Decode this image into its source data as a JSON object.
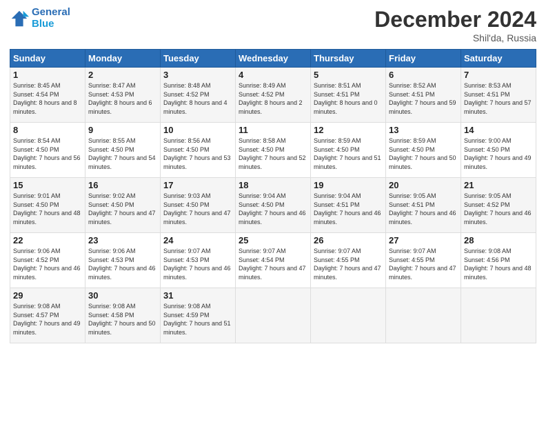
{
  "logo": {
    "line1": "General",
    "line2": "Blue"
  },
  "title": "December 2024",
  "location": "Shil'da, Russia",
  "days_of_week": [
    "Sunday",
    "Monday",
    "Tuesday",
    "Wednesday",
    "Thursday",
    "Friday",
    "Saturday"
  ],
  "weeks": [
    [
      {
        "day": "1",
        "sunrise": "Sunrise: 8:45 AM",
        "sunset": "Sunset: 4:54 PM",
        "daylight": "Daylight: 8 hours and 8 minutes."
      },
      {
        "day": "2",
        "sunrise": "Sunrise: 8:47 AM",
        "sunset": "Sunset: 4:53 PM",
        "daylight": "Daylight: 8 hours and 6 minutes."
      },
      {
        "day": "3",
        "sunrise": "Sunrise: 8:48 AM",
        "sunset": "Sunset: 4:52 PM",
        "daylight": "Daylight: 8 hours and 4 minutes."
      },
      {
        "day": "4",
        "sunrise": "Sunrise: 8:49 AM",
        "sunset": "Sunset: 4:52 PM",
        "daylight": "Daylight: 8 hours and 2 minutes."
      },
      {
        "day": "5",
        "sunrise": "Sunrise: 8:51 AM",
        "sunset": "Sunset: 4:51 PM",
        "daylight": "Daylight: 8 hours and 0 minutes."
      },
      {
        "day": "6",
        "sunrise": "Sunrise: 8:52 AM",
        "sunset": "Sunset: 4:51 PM",
        "daylight": "Daylight: 7 hours and 59 minutes."
      },
      {
        "day": "7",
        "sunrise": "Sunrise: 8:53 AM",
        "sunset": "Sunset: 4:51 PM",
        "daylight": "Daylight: 7 hours and 57 minutes."
      }
    ],
    [
      {
        "day": "8",
        "sunrise": "Sunrise: 8:54 AM",
        "sunset": "Sunset: 4:50 PM",
        "daylight": "Daylight: 7 hours and 56 minutes."
      },
      {
        "day": "9",
        "sunrise": "Sunrise: 8:55 AM",
        "sunset": "Sunset: 4:50 PM",
        "daylight": "Daylight: 7 hours and 54 minutes."
      },
      {
        "day": "10",
        "sunrise": "Sunrise: 8:56 AM",
        "sunset": "Sunset: 4:50 PM",
        "daylight": "Daylight: 7 hours and 53 minutes."
      },
      {
        "day": "11",
        "sunrise": "Sunrise: 8:58 AM",
        "sunset": "Sunset: 4:50 PM",
        "daylight": "Daylight: 7 hours and 52 minutes."
      },
      {
        "day": "12",
        "sunrise": "Sunrise: 8:59 AM",
        "sunset": "Sunset: 4:50 PM",
        "daylight": "Daylight: 7 hours and 51 minutes."
      },
      {
        "day": "13",
        "sunrise": "Sunrise: 8:59 AM",
        "sunset": "Sunset: 4:50 PM",
        "daylight": "Daylight: 7 hours and 50 minutes."
      },
      {
        "day": "14",
        "sunrise": "Sunrise: 9:00 AM",
        "sunset": "Sunset: 4:50 PM",
        "daylight": "Daylight: 7 hours and 49 minutes."
      }
    ],
    [
      {
        "day": "15",
        "sunrise": "Sunrise: 9:01 AM",
        "sunset": "Sunset: 4:50 PM",
        "daylight": "Daylight: 7 hours and 48 minutes."
      },
      {
        "day": "16",
        "sunrise": "Sunrise: 9:02 AM",
        "sunset": "Sunset: 4:50 PM",
        "daylight": "Daylight: 7 hours and 47 minutes."
      },
      {
        "day": "17",
        "sunrise": "Sunrise: 9:03 AM",
        "sunset": "Sunset: 4:50 PM",
        "daylight": "Daylight: 7 hours and 47 minutes."
      },
      {
        "day": "18",
        "sunrise": "Sunrise: 9:04 AM",
        "sunset": "Sunset: 4:50 PM",
        "daylight": "Daylight: 7 hours and 46 minutes."
      },
      {
        "day": "19",
        "sunrise": "Sunrise: 9:04 AM",
        "sunset": "Sunset: 4:51 PM",
        "daylight": "Daylight: 7 hours and 46 minutes."
      },
      {
        "day": "20",
        "sunrise": "Sunrise: 9:05 AM",
        "sunset": "Sunset: 4:51 PM",
        "daylight": "Daylight: 7 hours and 46 minutes."
      },
      {
        "day": "21",
        "sunrise": "Sunrise: 9:05 AM",
        "sunset": "Sunset: 4:52 PM",
        "daylight": "Daylight: 7 hours and 46 minutes."
      }
    ],
    [
      {
        "day": "22",
        "sunrise": "Sunrise: 9:06 AM",
        "sunset": "Sunset: 4:52 PM",
        "daylight": "Daylight: 7 hours and 46 minutes."
      },
      {
        "day": "23",
        "sunrise": "Sunrise: 9:06 AM",
        "sunset": "Sunset: 4:53 PM",
        "daylight": "Daylight: 7 hours and 46 minutes."
      },
      {
        "day": "24",
        "sunrise": "Sunrise: 9:07 AM",
        "sunset": "Sunset: 4:53 PM",
        "daylight": "Daylight: 7 hours and 46 minutes."
      },
      {
        "day": "25",
        "sunrise": "Sunrise: 9:07 AM",
        "sunset": "Sunset: 4:54 PM",
        "daylight": "Daylight: 7 hours and 47 minutes."
      },
      {
        "day": "26",
        "sunrise": "Sunrise: 9:07 AM",
        "sunset": "Sunset: 4:55 PM",
        "daylight": "Daylight: 7 hours and 47 minutes."
      },
      {
        "day": "27",
        "sunrise": "Sunrise: 9:07 AM",
        "sunset": "Sunset: 4:55 PM",
        "daylight": "Daylight: 7 hours and 47 minutes."
      },
      {
        "day": "28",
        "sunrise": "Sunrise: 9:08 AM",
        "sunset": "Sunset: 4:56 PM",
        "daylight": "Daylight: 7 hours and 48 minutes."
      }
    ],
    [
      {
        "day": "29",
        "sunrise": "Sunrise: 9:08 AM",
        "sunset": "Sunset: 4:57 PM",
        "daylight": "Daylight: 7 hours and 49 minutes."
      },
      {
        "day": "30",
        "sunrise": "Sunrise: 9:08 AM",
        "sunset": "Sunset: 4:58 PM",
        "daylight": "Daylight: 7 hours and 50 minutes."
      },
      {
        "day": "31",
        "sunrise": "Sunrise: 9:08 AM",
        "sunset": "Sunset: 4:59 PM",
        "daylight": "Daylight: 7 hours and 51 minutes."
      },
      null,
      null,
      null,
      null
    ]
  ]
}
